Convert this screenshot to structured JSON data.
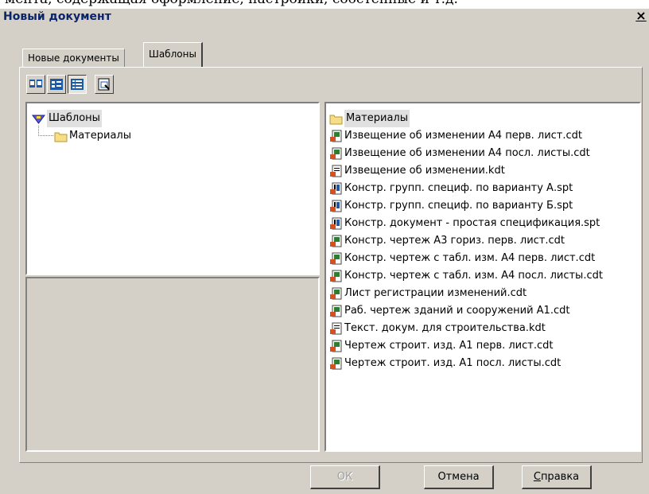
{
  "page_overlay_text": "мента, содержащая оформление, настройки, собстенные и т.д.",
  "dialog": {
    "title": "Новый документ",
    "close_glyph": "×"
  },
  "tabs": [
    {
      "label": "Новые документы"
    },
    {
      "label": "Шаблоны",
      "active": true
    }
  ],
  "toolbar": {
    "buttons": [
      "large-icons",
      "small-icons",
      "list-view",
      "preview-toggle"
    ]
  },
  "tree": {
    "root": "Шаблоны",
    "children": [
      "Материалы"
    ]
  },
  "files": [
    {
      "name": "Материалы",
      "icon": "folder-icon",
      "selected": true
    },
    {
      "name": "Извещение об изменении А4 перв. лист.cdt",
      "icon": "cdt-icon"
    },
    {
      "name": "Извещение об изменении А4 посл. листы.cdt",
      "icon": "cdt-icon"
    },
    {
      "name": "Извещение об изменении.kdt",
      "icon": "kdt-icon"
    },
    {
      "name": "Констр. групп. специф. по варианту А.spt",
      "icon": "spt-icon"
    },
    {
      "name": "Констр. групп. специф. по варианту Б.spt",
      "icon": "spt-icon"
    },
    {
      "name": "Констр. документ - простая спецификация.spt",
      "icon": "spt-icon"
    },
    {
      "name": "Констр. чертеж А3 гориз. перв. лист.cdt",
      "icon": "cdt-icon"
    },
    {
      "name": "Констр. чертеж с табл. изм. А4 перв. лист.cdt",
      "icon": "cdt-icon"
    },
    {
      "name": "Констр. чертеж с табл. изм. А4 посл. листы.cdt",
      "icon": "cdt-icon"
    },
    {
      "name": "Лист регистрации изменений.cdt",
      "icon": "cdt-icon"
    },
    {
      "name": "Раб. чертеж зданий и сооружений А1.cdt",
      "icon": "cdt-icon"
    },
    {
      "name": "Текст. докум. для строительства.kdt",
      "icon": "kdt-icon"
    },
    {
      "name": "Чертеж  строит. изд. А1 перв. лист.cdt",
      "icon": "cdt-icon"
    },
    {
      "name": "Чертеж  строит. изд. А1 посл. листы.cdt",
      "icon": "cdt-icon"
    }
  ],
  "buttons": {
    "ok": "ОК",
    "cancel": "Отмена",
    "help_underlined": "С",
    "help_rest": "правка"
  }
}
